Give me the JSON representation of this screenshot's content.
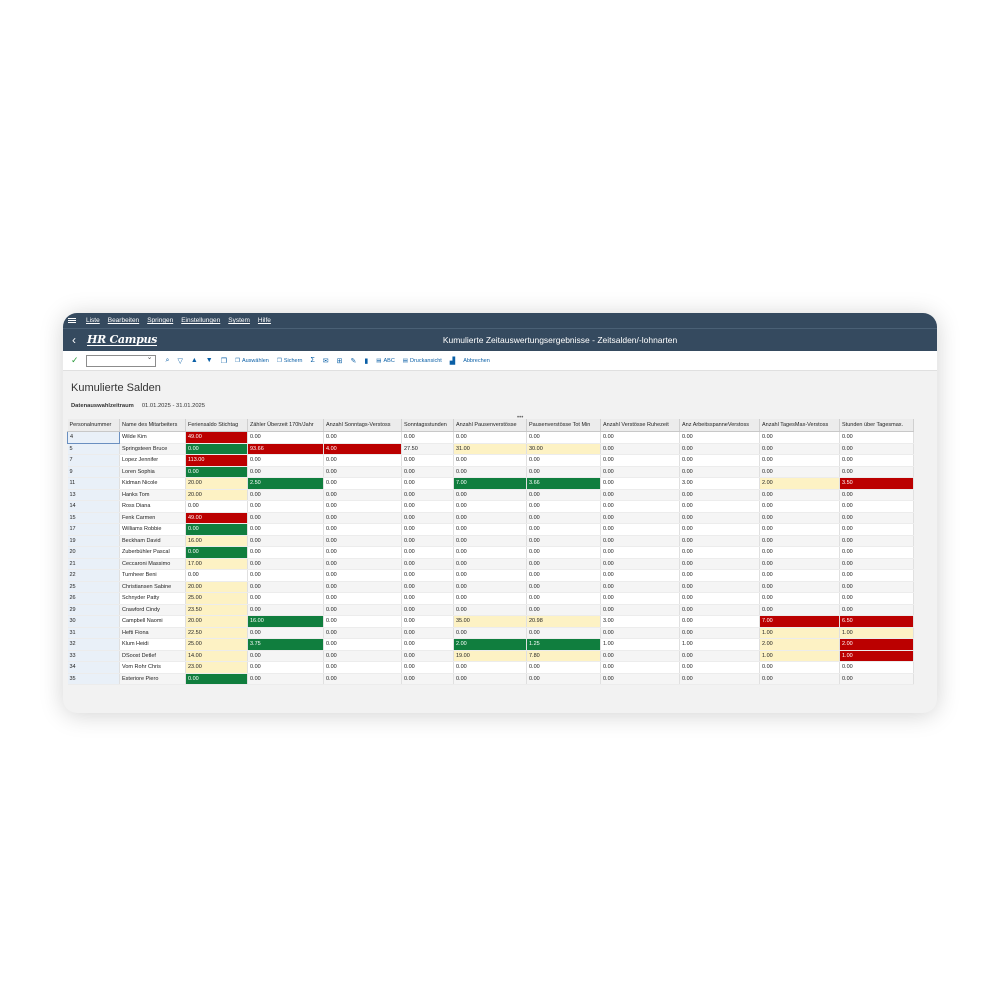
{
  "menu": [
    "Liste",
    "Bearbeiten",
    "Springen",
    "Einstellungen",
    "System",
    "Hilfe"
  ],
  "title_bar": {
    "logo": "HR Campus",
    "title": "Kumulierte Zeitauswertungsergebnisse - Zeitsalden/-lohnarten"
  },
  "toolbar": {
    "auswaehlen": "Auswählen",
    "sichern": "Sichern",
    "sigma": "Σ",
    "abc": "ABC",
    "druckansicht": "Druckansicht",
    "abbrechen": "Abbrechen"
  },
  "page": {
    "title": "Kumulierte Salden",
    "period_label": "Datenauswahlzeitraum",
    "period_value": "01.01.2025 - 31.01.2025"
  },
  "colors": {
    "red": "#bb0000",
    "green": "#107e3e",
    "yellow": "#fdf2c4",
    "header": "#354a5f"
  },
  "columns": [
    "Personalnummer",
    "Name des Mitarbeiters",
    "Feriensaldo Stichtag",
    "Zähler Überzeit 170h/Jahr",
    "Anzahl Sonntags-Verstoss",
    "Sonntagsstunden",
    "Anzahl Pausenverstösse",
    "Pausenverstösse Tot Min",
    "Anzahl Verstösse Ruhezeit",
    "Anz ArbeitsspanneVerstoss",
    "Anzahl TagesMax-Verstoss",
    "Stunden über Tagesmax."
  ],
  "rows": [
    {
      "cells": [
        "4",
        "Wilde Kim",
        "49.00",
        "0.00",
        "0.00",
        "0.00",
        "0.00",
        "0.00",
        "0.00",
        "0.00",
        "0.00",
        "0.00"
      ],
      "hl": {
        "2": "red"
      }
    },
    {
      "cells": [
        "5",
        "Springsteen Bruce",
        "0.00",
        "93.66",
        "4.00",
        "27.50",
        "31.00",
        "30.00",
        "0.00",
        "0.00",
        "0.00",
        "0.00"
      ],
      "hl": {
        "2": "green",
        "3": "red",
        "4": "red",
        "6": "yellow",
        "7": "yellow"
      }
    },
    {
      "cells": [
        "7",
        "Lopez Jennifer",
        "113.00",
        "0.00",
        "0.00",
        "0.00",
        "0.00",
        "0.00",
        "0.00",
        "0.00",
        "0.00",
        "0.00"
      ],
      "hl": {
        "2": "red"
      }
    },
    {
      "cells": [
        "9",
        "Loren Sophia",
        "0.00",
        "0.00",
        "0.00",
        "0.00",
        "0.00",
        "0.00",
        "0.00",
        "0.00",
        "0.00",
        "0.00"
      ],
      "hl": {
        "2": "green"
      }
    },
    {
      "cells": [
        "11",
        "Kidman Nicole",
        "20.00",
        "2.50",
        "0.00",
        "0.00",
        "7.00",
        "3.66",
        "0.00",
        "3.00",
        "2.00",
        "3.50"
      ],
      "hl": {
        "2": "yellow",
        "3": "green",
        "6": "green",
        "7": "green",
        "10": "yellow",
        "11": "red"
      }
    },
    {
      "cells": [
        "13",
        "Hanks Tom",
        "20.00",
        "0.00",
        "0.00",
        "0.00",
        "0.00",
        "0.00",
        "0.00",
        "0.00",
        "0.00",
        "0.00"
      ],
      "hl": {
        "2": "yellow"
      }
    },
    {
      "cells": [
        "14",
        "Ross Diana",
        "0.00",
        "0.00",
        "0.00",
        "0.00",
        "0.00",
        "0.00",
        "0.00",
        "0.00",
        "0.00",
        "0.00"
      ],
      "hl": {}
    },
    {
      "cells": [
        "15",
        "Fenk Carmen",
        "49.00",
        "0.00",
        "0.00",
        "0.00",
        "0.00",
        "0.00",
        "0.00",
        "0.00",
        "0.00",
        "0.00"
      ],
      "hl": {
        "2": "red"
      }
    },
    {
      "cells": [
        "17",
        "Williams Robbie",
        "0.00",
        "0.00",
        "0.00",
        "0.00",
        "0.00",
        "0.00",
        "0.00",
        "0.00",
        "0.00",
        "0.00"
      ],
      "hl": {
        "2": "green"
      }
    },
    {
      "cells": [
        "19",
        "Beckham David",
        "16.00",
        "0.00",
        "0.00",
        "0.00",
        "0.00",
        "0.00",
        "0.00",
        "0.00",
        "0.00",
        "0.00"
      ],
      "hl": {
        "2": "yellow"
      }
    },
    {
      "cells": [
        "20",
        "Zuberbühler Pascal",
        "0.00",
        "0.00",
        "0.00",
        "0.00",
        "0.00",
        "0.00",
        "0.00",
        "0.00",
        "0.00",
        "0.00"
      ],
      "hl": {
        "2": "green"
      }
    },
    {
      "cells": [
        "21",
        "Ceccaroni Massimo",
        "17.00",
        "0.00",
        "0.00",
        "0.00",
        "0.00",
        "0.00",
        "0.00",
        "0.00",
        "0.00",
        "0.00"
      ],
      "hl": {
        "2": "yellow"
      }
    },
    {
      "cells": [
        "22",
        "Turnheer Beni",
        "0.00",
        "0.00",
        "0.00",
        "0.00",
        "0.00",
        "0.00",
        "0.00",
        "0.00",
        "0.00",
        "0.00"
      ],
      "hl": {}
    },
    {
      "cells": [
        "25",
        "Christiansen Sabine",
        "20.00",
        "0.00",
        "0.00",
        "0.00",
        "0.00",
        "0.00",
        "0.00",
        "0.00",
        "0.00",
        "0.00"
      ],
      "hl": {
        "2": "yellow"
      }
    },
    {
      "cells": [
        "26",
        "Schnyder Patty",
        "25.00",
        "0.00",
        "0.00",
        "0.00",
        "0.00",
        "0.00",
        "0.00",
        "0.00",
        "0.00",
        "0.00"
      ],
      "hl": {
        "2": "yellow"
      }
    },
    {
      "cells": [
        "29",
        "Crawford Cindy",
        "23.50",
        "0.00",
        "0.00",
        "0.00",
        "0.00",
        "0.00",
        "0.00",
        "0.00",
        "0.00",
        "0.00"
      ],
      "hl": {
        "2": "yellow"
      }
    },
    {
      "cells": [
        "30",
        "Campbell Naomi",
        "20.00",
        "16.00",
        "0.00",
        "0.00",
        "35.00",
        "20.98",
        "3.00",
        "0.00",
        "7.00",
        "6.50"
      ],
      "hl": {
        "2": "yellow",
        "3": "green",
        "6": "yellow",
        "7": "yellow",
        "10": "red",
        "11": "red"
      }
    },
    {
      "cells": [
        "31",
        "Hefti Fiona",
        "22.50",
        "0.00",
        "0.00",
        "0.00",
        "0.00",
        "0.00",
        "0.00",
        "0.00",
        "1.00",
        "1.00"
      ],
      "hl": {
        "2": "yellow",
        "10": "yellow",
        "11": "yellow"
      }
    },
    {
      "cells": [
        "32",
        "Klum Heidi",
        "25.00",
        "3.75",
        "0.00",
        "0.00",
        "2.00",
        "1.25",
        "1.00",
        "1.00",
        "2.00",
        "2.00"
      ],
      "hl": {
        "2": "yellow",
        "3": "green",
        "6": "green",
        "7": "green",
        "10": "yellow",
        "11": "red"
      }
    },
    {
      "cells": [
        "33",
        "DSoost Detlef",
        "14.00",
        "0.00",
        "0.00",
        "0.00",
        "19.00",
        "7.80",
        "0.00",
        "0.00",
        "1.00",
        "1.00"
      ],
      "hl": {
        "2": "yellow",
        "6": "yellow",
        "7": "yellow",
        "10": "yellow",
        "11": "red"
      }
    },
    {
      "cells": [
        "34",
        "Vom Rohr Chris",
        "23.00",
        "0.00",
        "0.00",
        "0.00",
        "0.00",
        "0.00",
        "0.00",
        "0.00",
        "0.00",
        "0.00"
      ],
      "hl": {
        "2": "yellow"
      }
    },
    {
      "cells": [
        "35",
        "Esteriore Piero",
        "0.00",
        "0.00",
        "0.00",
        "0.00",
        "0.00",
        "0.00",
        "0.00",
        "0.00",
        "0.00",
        "0.00"
      ],
      "hl": {
        "2": "green"
      }
    }
  ]
}
